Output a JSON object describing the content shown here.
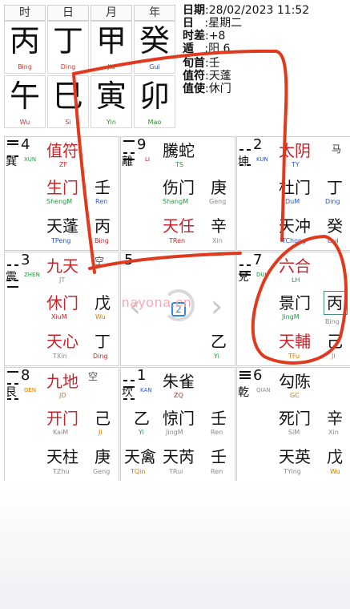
{
  "pillars": [
    {
      "head": "时",
      "top": "丙",
      "top_pin": "Bing",
      "bottom": "午",
      "bottom_pin": "Wu"
    },
    {
      "head": "日",
      "top": "丁",
      "top_pin": "Ding",
      "bottom": "巳",
      "bottom_pin": "Si"
    },
    {
      "head": "月",
      "top": "甲",
      "top_pin": "Jia",
      "bottom": "寅",
      "bottom_pin": "Yin"
    },
    {
      "head": "年",
      "top": "癸",
      "top_pin": "Gui",
      "bottom": "卯",
      "bottom_pin": "Mao"
    }
  ],
  "info": {
    "date_label": "日期",
    "date_value": ":28/02/2023 11:52",
    "day_label": "日",
    "day_value": ":星期二",
    "tz_label": "时差",
    "tz_value": ":+8",
    "ju_label": "遁",
    "ju_value": ":阳 6",
    "xunshou_label": "旬首",
    "xunshou_value": ":壬",
    "zhifu_label": "值符",
    "zhifu_value": ":天蓬",
    "zhishi_label": "值使",
    "zhishi_value": ":休门"
  },
  "palaces": {
    "xun": {
      "num": "4",
      "gua": "巽",
      "gua_pin": "XUN",
      "shen": "值符",
      "shen_pin": "ZF",
      "men": "生门",
      "men_pin": "ShengM",
      "xing": "天蓬",
      "xing_pin": "TPeng",
      "tian": "壬",
      "tian_pin": "Ren",
      "di": "丙",
      "di_pin": "Bing"
    },
    "li": {
      "num": "9",
      "gua": "離",
      "gua_pin": "LI",
      "shen": "騰蛇",
      "shen_pin": "TS",
      "men": "伤门",
      "men_pin": "ShangM",
      "xing": "天任",
      "xing_pin": "TRen",
      "tian": "庚",
      "tian_pin": "Geng",
      "di": "辛",
      "di_pin": "Xin"
    },
    "kun": {
      "num": "2",
      "gua": "坤",
      "gua_pin": "KUN",
      "shen": "太阴",
      "shen_pin": "TY",
      "men": "杜门",
      "men_pin": "DuM",
      "xing": "天冲",
      "xing_pin": "TChong",
      "tian": "丁",
      "tian_pin": "Ding",
      "di": "癸",
      "di_pin": "Gui",
      "horse": "马"
    },
    "zhen": {
      "num": "3",
      "gua": "震",
      "gua_pin": "ZHEN",
      "shen": "九天",
      "shen_pin": "JT",
      "men": "休门",
      "men_pin": "XiuM",
      "xing": "天心",
      "xing_pin": "TXin",
      "tian": "戊",
      "tian_pin": "Wu",
      "di": "丁",
      "di_pin": "Ding",
      "kong": "空"
    },
    "center": {
      "num": "5",
      "badge": "2",
      "di": "乙",
      "di_pin": "Yi"
    },
    "dui": {
      "num": "7",
      "gua": "兌",
      "gua_pin": "DUI",
      "shen": "六合",
      "shen_pin": "LH",
      "men": "景门",
      "men_pin": "JingM",
      "xing": "天輔",
      "xing_pin": "TFu",
      "tian": "丙",
      "tian_pin": "Bing",
      "di": "己",
      "di_pin": "Ji"
    },
    "gen": {
      "num": "8",
      "gua": "艮",
      "gua_pin": "GEN",
      "shen": "九地",
      "shen_pin": "JD",
      "men": "开门",
      "men_pin": "KaiM",
      "xing": "天柱",
      "xing_pin": "TZhu",
      "tian": "己",
      "tian_pin": "Ji",
      "di": "庚",
      "di_pin": "Geng",
      "kong": "空"
    },
    "kan": {
      "num": "1",
      "gua": "坎",
      "gua_pin": "KAN",
      "shen": "朱雀",
      "shen_pin": "ZQ",
      "men": "惊门",
      "men_pin": "JingM",
      "xing": "天芮",
      "xing_pin": "TRui",
      "tian": "乙",
      "tian_pin": "Yi",
      "di": "壬",
      "di_pin": "Ren",
      "qin": "天禽",
      "qin_pin": "TQin",
      "qin_tian": "",
      "men_tian": "乙",
      "men_tian_pin": "Yi"
    },
    "qian": {
      "num": "6",
      "gua": "乾",
      "gua_pin": "QIAN",
      "shen": "勾陈",
      "shen_pin": "GC",
      "men": "死门",
      "men_pin": "SiM",
      "xing": "天英",
      "xing_pin": "TYing",
      "tian": "辛",
      "tian_pin": "Xin",
      "di": "戊",
      "di_pin": "Wu"
    }
  },
  "watermark": "nayona.cn",
  "colors": {
    "accent_red": "#c0262b",
    "annotation": "#e03a1e",
    "teal_box": "#4a8a80"
  }
}
